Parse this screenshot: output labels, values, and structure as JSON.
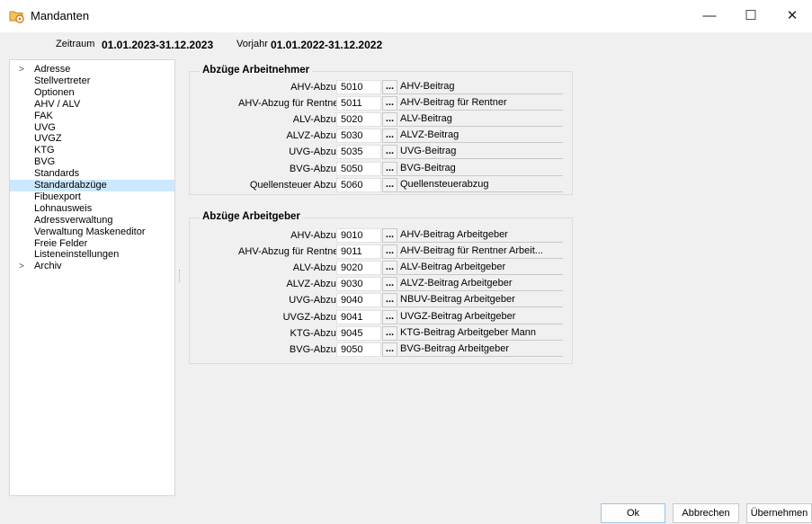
{
  "window": {
    "title": "Mandanten",
    "minimize_glyph": "—",
    "maximize_glyph": "☐",
    "close_glyph": "✕",
    "icon": "folder-gear-icon"
  },
  "period": {
    "zeitraum_label": "Zeitraum",
    "zeitraum_value": "01.01.2023-31.12.2023",
    "vorjahr_label": "Vorjahr",
    "vorjahr_value": "01.01.2022-31.12.2022"
  },
  "tree": {
    "items": [
      {
        "label": "Adresse",
        "expandable": true,
        "selected": false
      },
      {
        "label": "Stellvertreter",
        "expandable": false,
        "selected": false
      },
      {
        "label": "Optionen",
        "expandable": false,
        "selected": false
      },
      {
        "label": "AHV / ALV",
        "expandable": false,
        "selected": false
      },
      {
        "label": "FAK",
        "expandable": false,
        "selected": false
      },
      {
        "label": "UVG",
        "expandable": false,
        "selected": false
      },
      {
        "label": "UVGZ",
        "expandable": false,
        "selected": false
      },
      {
        "label": "KTG",
        "expandable": false,
        "selected": false
      },
      {
        "label": "BVG",
        "expandable": false,
        "selected": false
      },
      {
        "label": "Standards",
        "expandable": false,
        "selected": false
      },
      {
        "label": "Standardabzüge",
        "expandable": false,
        "selected": true
      },
      {
        "label": "Fibuexport",
        "expandable": false,
        "selected": false
      },
      {
        "label": "Lohnausweis",
        "expandable": false,
        "selected": false
      },
      {
        "label": "Adressverwaltung",
        "expandable": false,
        "selected": false
      },
      {
        "label": "Verwaltung Maskeneditor",
        "expandable": false,
        "selected": false
      },
      {
        "label": "Freie Felder",
        "expandable": false,
        "selected": false
      },
      {
        "label": "Listeneinstellungen",
        "expandable": false,
        "selected": false
      },
      {
        "label": "Archiv",
        "expandable": true,
        "selected": false
      }
    ]
  },
  "arbeitnehmer": {
    "title": "Abzüge Arbeitnehmer",
    "rows": [
      {
        "label": "AHV-Abzug",
        "code": "5010",
        "button": "...",
        "description": "AHV-Beitrag"
      },
      {
        "label": "AHV-Abzug für Rentner",
        "code": "5011",
        "button": "...",
        "description": "AHV-Beitrag für Rentner"
      },
      {
        "label": "ALV-Abzug",
        "code": "5020",
        "button": "...",
        "description": "ALV-Beitrag"
      },
      {
        "label": "ALVZ-Abzug",
        "code": "5030",
        "button": "...",
        "description": "ALVZ-Beitrag"
      },
      {
        "label": "UVG-Abzug",
        "code": "5035",
        "button": "...",
        "description": "UVG-Beitrag"
      },
      {
        "label": "BVG-Abzug",
        "code": "5050",
        "button": "...",
        "description": "BVG-Beitrag"
      },
      {
        "label": "Quellensteuer Abzug",
        "code": "5060",
        "button": "...",
        "description": "Quellensteuerabzug"
      }
    ]
  },
  "arbeitgeber": {
    "title": "Abzüge Arbeitgeber",
    "rows": [
      {
        "label": "AHV-Abzug",
        "code": "9010",
        "button": "...",
        "description": "AHV-Beitrag Arbeitgeber"
      },
      {
        "label": "AHV-Abzug für Rentner",
        "code": "9011",
        "button": "...",
        "description": "AHV-Beitrag für Rentner Arbeit..."
      },
      {
        "label": "ALV-Abzug",
        "code": "9020",
        "button": "...",
        "description": "ALV-Beitrag Arbeitgeber"
      },
      {
        "label": "ALVZ-Abzug",
        "code": "9030",
        "button": "...",
        "description": "ALVZ-Beitrag Arbeitgeber"
      },
      {
        "label": "UVG-Abzug",
        "code": "9040",
        "button": "...",
        "description": "NBUV-Beitrag Arbeitgeber"
      },
      {
        "label": "UVGZ-Abzug",
        "code": "9041",
        "button": "...",
        "description": "UVGZ-Beitrag Arbeitgeber"
      },
      {
        "label": "KTG-Abzug",
        "code": "9045",
        "button": "...",
        "description": "KTG-Beitrag Arbeitgeber Mann"
      },
      {
        "label": "BVG-Abzug",
        "code": "9050",
        "button": "...",
        "description": "BVG-Beitrag Arbeitgeber"
      }
    ]
  },
  "buttons": {
    "ok": "Ok",
    "cancel": "Abbrechen",
    "apply": "Übernehmen"
  },
  "colors": {
    "selection": "#cce8ff",
    "accent_icon": "#e8a33d"
  }
}
